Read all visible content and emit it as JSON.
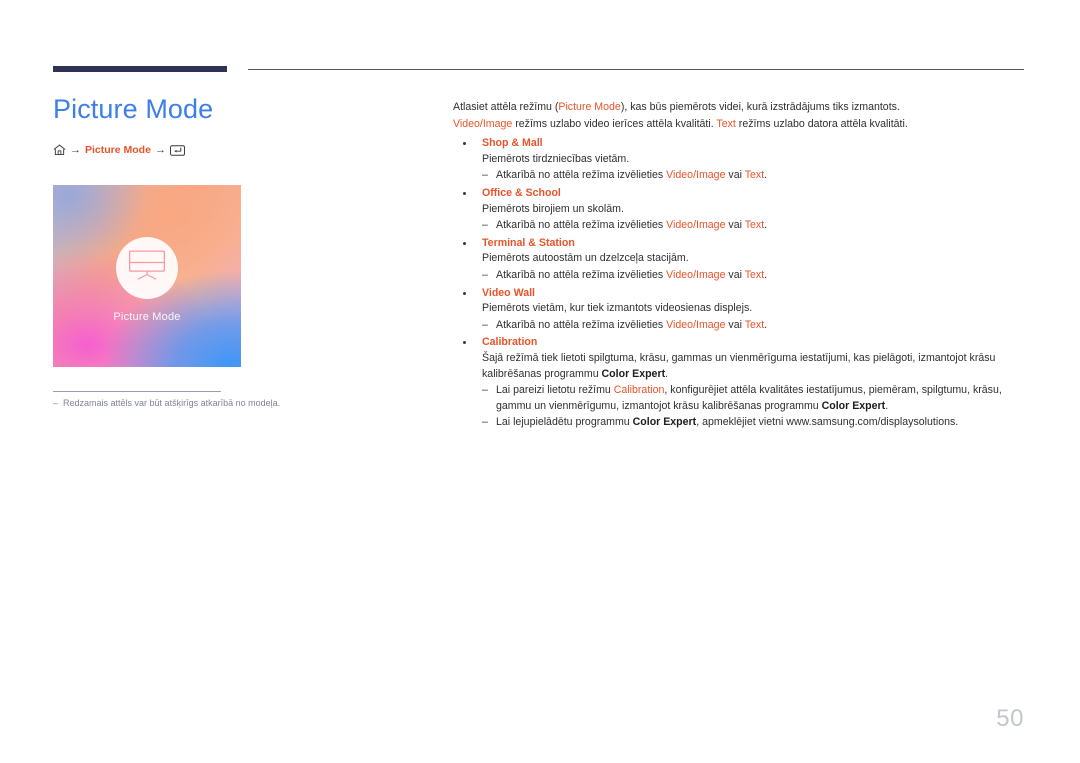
{
  "header": {
    "accent_navy": "#2e3355",
    "rule_color": "#55566d"
  },
  "left": {
    "title": "Picture Mode",
    "title_color": "#3d7fe8",
    "breadcrumb": {
      "home_icon": "home-icon",
      "arrow": "→",
      "label": "Picture Mode",
      "enter_icon": "enter-key-icon",
      "accent": "#e8542a"
    },
    "thumbnail": {
      "caption": "Picture Mode",
      "icon": "monitor-icon"
    },
    "note": {
      "dash": "–",
      "text": "Redzamais attēls var būt atšķirīgs atkarībā no modeļa."
    }
  },
  "main": {
    "intro": {
      "line1_a": "Atlasiet attēla režīmu (",
      "line1_hl": "Picture Mode",
      "line1_b": "), kas būs piemērots videi, kurā izstrādājums tiks izmantots.",
      "line2_hl1": "Video/Image",
      "line2_a": " režīms uzlabo video ierīces attēla kvalitāti. ",
      "line2_hl2": "Text",
      "line2_b": " režīms uzlabo datora attēla kvalitāti."
    },
    "sub_prefix": "Atkarībā no attēla režīma izvēlieties ",
    "sub_mid": " vai ",
    "sub_suffix": ".",
    "hl_video_image": "Video/Image",
    "hl_text": "Text",
    "items": [
      {
        "title": "Shop & Mall",
        "desc": "Piemērots tirdzniecības vietām."
      },
      {
        "title": "Office & School",
        "desc": "Piemērots birojiem un skolām."
      },
      {
        "title": "Terminal & Station",
        "desc": "Piemērots autoostām un dzelzceļa stacijām."
      },
      {
        "title": "Video Wall",
        "desc": "Piemērots vietām, kur tiek izmantots videosienas displejs."
      }
    ],
    "calibration": {
      "title": "Calibration",
      "desc_a": "Šajā režīmā tiek lietoti spilgtuma, krāsu, gammas un vienmērīguma iestatījumi, kas pielāgoti, izmantojot krāsu kalibrēšanas programmu ",
      "desc_bold": "Color Expert",
      "desc_b": ".",
      "sub1_a": "Lai pareizi lietotu režīmu ",
      "sub1_hl": "Calibration",
      "sub1_b": ", konfigurējiet attēla kvalitātes iestatījumus, piemēram, spilgtumu, krāsu, gammu un vienmērīgumu, izmantojot krāsu kalibrēšanas programmu ",
      "sub1_bold": "Color Expert",
      "sub1_c": ".",
      "sub2_a": "Lai lejupielādētu programmu ",
      "sub2_bold": "Color Expert",
      "sub2_b": ", apmeklējiet vietni www.samsung.com/displaysolutions."
    }
  },
  "footer": {
    "page_number": "50"
  }
}
